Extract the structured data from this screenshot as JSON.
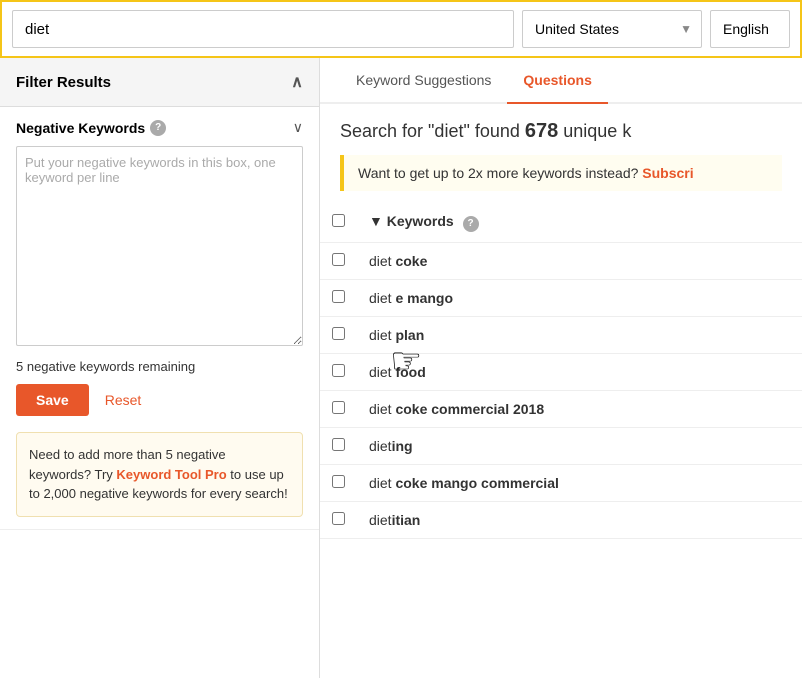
{
  "topbar": {
    "search_value": "diet",
    "country_value": "United States",
    "language_value": "English"
  },
  "sidebar": {
    "filter_title": "Filter Results",
    "negative_keywords_title": "Negative Keywords",
    "textarea_placeholder": "Put your negative keywords in this box, one keyword per line",
    "remaining_text": "5 negative keywords remaining",
    "save_label": "Save",
    "reset_label": "Reset",
    "promo_text_before": "Need to add more than 5 negative keywords? Try ",
    "promo_link_text": "Keyword Tool Pro",
    "promo_text_after": " to use up to 2,000 negative keywords for every search!"
  },
  "content": {
    "tabs": [
      {
        "label": "Keyword Suggestions",
        "active": false
      },
      {
        "label": "Questions",
        "active": true
      }
    ],
    "result_text_before": "Search for \"diet\" found ",
    "result_count": "678",
    "result_text_after": " unique k",
    "subscribe_text": "Want to get up to 2x more keywords instead? ",
    "subscribe_link": "Subscri",
    "keywords_column_label": "Keywords",
    "keywords": [
      {
        "text_plain": "diet ",
        "text_bold": "coke"
      },
      {
        "text_plain": "diet ",
        "text_bold": "e mango"
      },
      {
        "text_plain": "diet ",
        "text_bold": "plan"
      },
      {
        "text_plain": "diet ",
        "text_bold": "food"
      },
      {
        "text_plain": "diet ",
        "text_bold": "coke commercial 2018"
      },
      {
        "text_plain": "diet",
        "text_bold": "ing"
      },
      {
        "text_plain": "diet ",
        "text_bold": "coke mango commercial"
      },
      {
        "text_plain": "diet",
        "text_bold": "itian"
      }
    ]
  }
}
